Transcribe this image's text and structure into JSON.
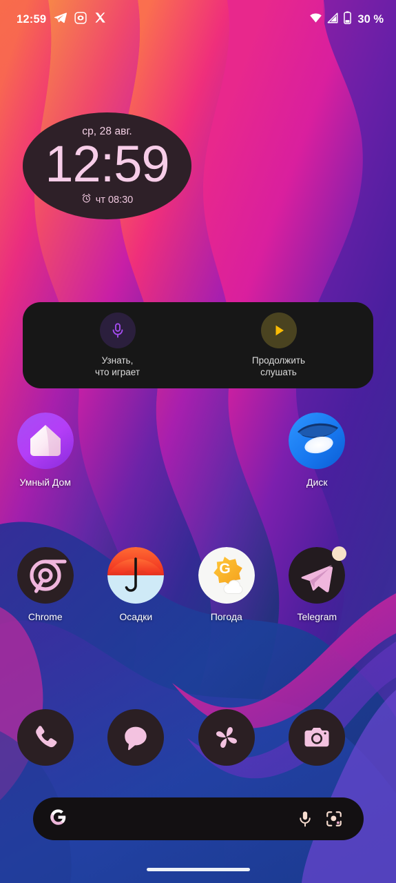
{
  "status_bar": {
    "clock": "12:59",
    "battery_percent": "30 %",
    "notification_icons": [
      "telegram-icon",
      "messenger-chat-icon",
      "x-twitter-icon"
    ],
    "system_icons": [
      "wifi-icon",
      "cellular-signal-icon",
      "battery-icon"
    ]
  },
  "clock_widget": {
    "date": "ср, 28 авг.",
    "time": "12:59",
    "alarm": "чт 08:30",
    "alarm_icon": "alarm-clock-icon",
    "background_color": "#2e2028",
    "text_color": "#f7cde8"
  },
  "media_widget": {
    "background_color": "#171717",
    "actions": [
      {
        "label": "Узнать,\nчто играет",
        "icon": "microphone-icon",
        "icon_color": "#a44df0",
        "circle_color": "#2b1f3d"
      },
      {
        "label": "Продолжить\nслушать",
        "icon": "play-icon",
        "icon_color": "#fbbc04",
        "circle_color": "#4a4320"
      }
    ]
  },
  "app_grid": {
    "rows": [
      [
        {
          "label": "Умный Дом",
          "icon": "smart-home-icon",
          "badge": false
        },
        {
          "label": "",
          "icon": "empty-slot",
          "badge": false
        },
        {
          "label": "",
          "icon": "empty-slot",
          "badge": false
        },
        {
          "label": "Диск",
          "icon": "yandex-disk-icon",
          "badge": false
        }
      ],
      [
        {
          "label": "Chrome",
          "icon": "chrome-icon",
          "badge": false
        },
        {
          "label": "Осадки",
          "icon": "umbrella-precipitation-icon",
          "badge": false
        },
        {
          "label": "Погода",
          "icon": "gismeteo-weather-icon",
          "badge": false
        },
        {
          "label": "Telegram",
          "icon": "telegram-icon",
          "badge": true
        }
      ]
    ]
  },
  "dock": {
    "items": [
      {
        "name": "Phone",
        "icon": "phone-icon"
      },
      {
        "name": "Messages",
        "icon": "message-bubble-icon"
      },
      {
        "name": "Photos",
        "icon": "photos-pinwheel-icon"
      },
      {
        "name": "Camera",
        "icon": "camera-icon"
      }
    ],
    "icon_background": "#2b1f23",
    "icon_color": "#f3c2e0"
  },
  "search_bar": {
    "placeholder": "",
    "value": "",
    "left_icon": "google-g-icon",
    "right_icons": [
      "microphone-icon",
      "google-lens-icon"
    ],
    "background_color": "#131012"
  },
  "nav_bar": {
    "gesture_pill": "home-gesture-pill"
  },
  "wallpaper": {
    "style": "abstract-flowing-waves",
    "colors": [
      "#f4693f",
      "#ef3f6e",
      "#e6288f",
      "#b41fa8",
      "#7a1fa0",
      "#4c1f8e",
      "#2a2a80",
      "#1b3e8f",
      "#16357a"
    ]
  }
}
